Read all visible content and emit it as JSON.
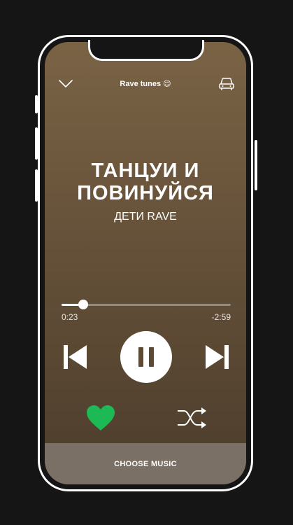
{
  "header": {
    "playlist_title": "Rave tunes 😌",
    "collapse_icon": "chevron-down-icon",
    "device_icon": "car-icon"
  },
  "track": {
    "title": "ТАНЦУИ И ПОВИНУЙСЯ",
    "artist": "ДЕТИ RAVE"
  },
  "progress": {
    "elapsed": "0:23",
    "remaining": "-2:59",
    "fraction": 0.13
  },
  "controls": {
    "previous_icon": "skip-previous-icon",
    "pause_icon": "pause-icon",
    "next_icon": "skip-next-icon",
    "like_icon": "heart-icon",
    "shuffle_icon": "shuffle-icon",
    "like_color": "#1db954"
  },
  "footer": {
    "choose_label": "CHOOSE MUSIC"
  },
  "colors": {
    "background": "#151515",
    "gradient_top": "#7a6345",
    "gradient_bottom": "#4b3c2b",
    "footer_bg": "#7a7065"
  }
}
